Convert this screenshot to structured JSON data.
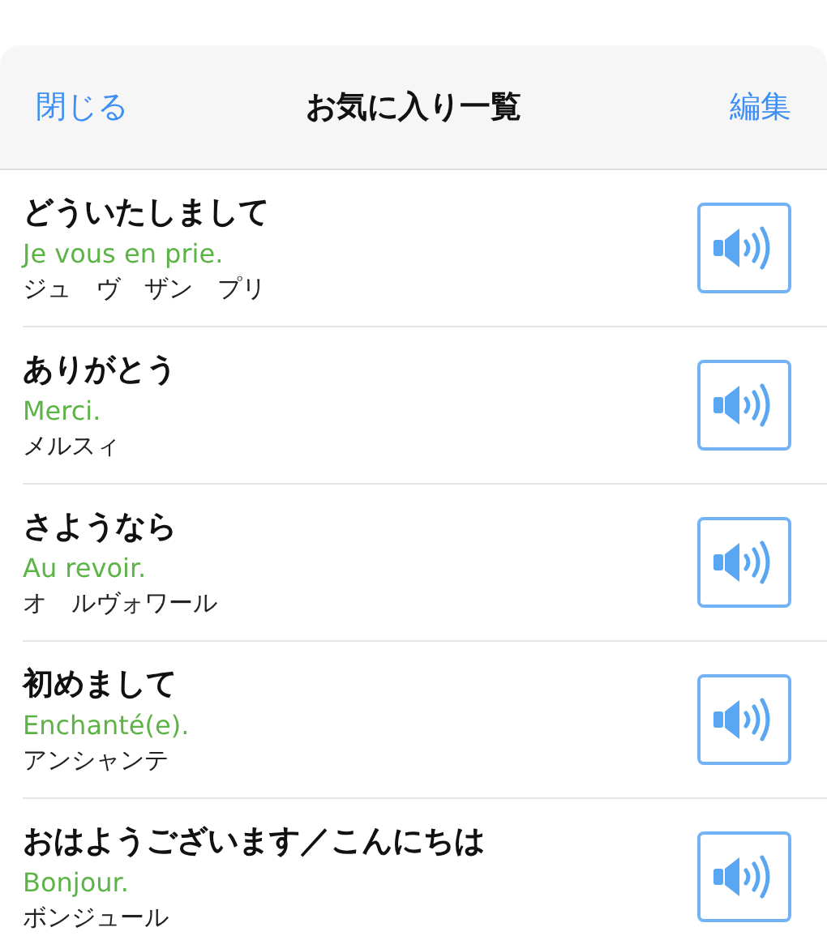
{
  "nav": {
    "close": "閉じる",
    "title": "お気に入り一覧",
    "edit": "編集"
  },
  "phrases": [
    {
      "japanese": "どういたしまして",
      "french": "Je vous en prie.",
      "reading": "ジュ　ヴ　ザン　プリ"
    },
    {
      "japanese": "ありがとう",
      "french": "Merci.",
      "reading": "メルスィ"
    },
    {
      "japanese": "さようなら",
      "french": "Au revoir.",
      "reading": "オ　ルヴォワール"
    },
    {
      "japanese": "初めまして",
      "french": "Enchanté(e).",
      "reading": "アンシャンテ"
    },
    {
      "japanese": "おはようございます／こんにちは",
      "french": "Bonjour.",
      "reading": "ボンジュール"
    }
  ]
}
